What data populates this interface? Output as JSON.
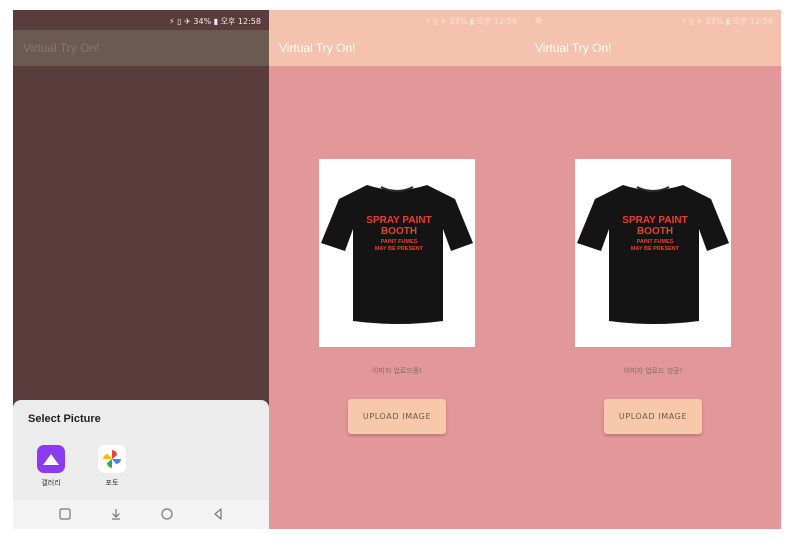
{
  "screens": [
    {
      "app_title": "Virtual Try On!",
      "status": {
        "left": "",
        "right": "⚡ ▯ ✈ 34% ▮ 오후 12:58"
      },
      "picker": {
        "title": "Select Picture",
        "apps": [
          {
            "label": "갤러리",
            "icon": "gallery-icon"
          },
          {
            "label": "포토",
            "icon": "photos-pinwheel-icon"
          }
        ]
      },
      "nav_icons": [
        "recent-apps-icon",
        "download-icon",
        "home-icon",
        "back-icon"
      ]
    },
    {
      "app_title": "Virtual Try On!",
      "status": {
        "left": "",
        "right": "⚡ ▯ ✈ 33% ▮ 오후 12:59"
      },
      "tshirt_text": [
        "SPRAY PAINT",
        "BOOTH",
        "PAINT FUMES",
        "MAY BE PRESENT"
      ],
      "caption": "이미지 업로드중!",
      "button": "UPLOAD IMAGE"
    },
    {
      "app_title": "Virtual Try On!",
      "status": {
        "left": "⊞",
        "right": "⚡ ▯ ✈ 33% ▮ 오후 12:59"
      },
      "tshirt_text": [
        "SPRAY PAINT",
        "BOOTH",
        "PAINT FUMES",
        "MAY BE PRESENT"
      ],
      "caption": "이미지 업로드 성공!",
      "button": "UPLOAD IMAGE"
    }
  ],
  "colors": {
    "app_bar": "#f5c2ad",
    "background": "#e29898",
    "button": "#f7c8aa",
    "print_text": "#e8422e"
  }
}
